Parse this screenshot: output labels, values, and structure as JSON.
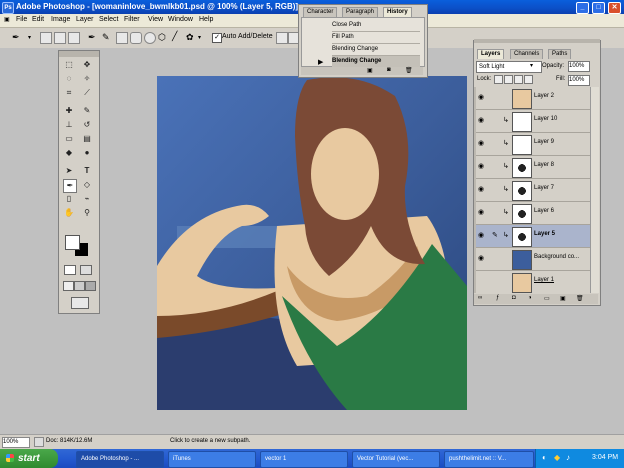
{
  "window": {
    "title": "Adobe Photoshop - [womaninlove_bwmlkb01.psd @ 100% (Layer 5, RGB)]",
    "ps_icon": "Ps"
  },
  "menu": [
    "File",
    "Edit",
    "Image",
    "Layer",
    "Select",
    "Filter",
    "View",
    "Window",
    "Help"
  ],
  "options_bar": {
    "auto_add_delete_label": "Auto Add/Delete",
    "auto_add_delete_checked": true
  },
  "history_panel": {
    "tabs": [
      "Character",
      "Paragraph",
      "History"
    ],
    "active_tab": "History",
    "items": [
      "Close Path",
      "Fill Path",
      "Blending Change",
      "Blending Change"
    ],
    "selected_index": 3
  },
  "layers_panel": {
    "tabs": [
      "Layers",
      "Channels",
      "Paths"
    ],
    "active_tab": "Layers",
    "blend_mode": "Soft Light",
    "opacity_label": "Opacity:",
    "opacity_value": "100%",
    "lock_label": "Lock:",
    "fill_label": "Fill:",
    "fill_value": "100%",
    "layers": [
      {
        "name": "Layer 2",
        "visible": true,
        "active": false
      },
      {
        "name": "Layer 10",
        "visible": true,
        "active": false
      },
      {
        "name": "Layer 9",
        "visible": true,
        "active": false
      },
      {
        "name": "Layer 8",
        "visible": true,
        "active": false
      },
      {
        "name": "Layer 7",
        "visible": true,
        "active": false
      },
      {
        "name": "Layer 6",
        "visible": true,
        "active": false
      },
      {
        "name": "Layer 5",
        "visible": true,
        "active": true
      },
      {
        "name": "Background co...",
        "visible": true,
        "active": false
      },
      {
        "name": "Layer 1",
        "visible": false,
        "active": false
      }
    ]
  },
  "status_bar": {
    "zoom": "100%",
    "doc_info": "Doc: 814K/12.6M",
    "hint": "Click to create a new subpath."
  },
  "taskbar": {
    "start_label": "start",
    "items": [
      {
        "label": "Adobe Photoshop - ...",
        "active": true
      },
      {
        "label": "iTunes",
        "active": false
      },
      {
        "label": "vector 1",
        "active": false
      },
      {
        "label": "Vector Tutorial (vec...",
        "active": false
      },
      {
        "label": "pushthelimit.net :: V...",
        "active": false
      }
    ],
    "clock": "3:04 PM"
  },
  "colors": {
    "canvas_bg": "#3c5e9c",
    "hair": "#7b4a36",
    "skin": "#e8c9a0",
    "dress": "#2a7a45",
    "titlebar": "#0b4fc7"
  }
}
